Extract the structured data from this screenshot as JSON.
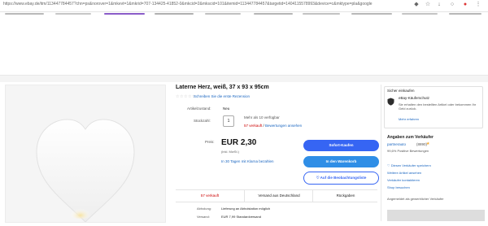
{
  "browser": {
    "url": "https://www.ebay.de/itm/113447784457?chn=ps&norover=1&mkevt=1&mkrid=707-134425-41852-0&mkcid=2&mkscid=101&itemid=113447784457&targetid=1404115578993&device=c&mktype=pla&google"
  },
  "product": {
    "title": "Laterne Herz, weiß, 37 x 93 x 95cm",
    "stars": "☆☆☆☆☆",
    "review_link": "Schreiben Sie die erste Rezension",
    "condition_label": "Artikelzustand:",
    "condition_value": "Neu",
    "quantity_label": "Stückzahl:",
    "quantity_value": "1",
    "availability": "Mehr als 10 verfügbar",
    "sold_text": "57 verkauft",
    "sold_link": "Bewertungen ansehen",
    "price_label": "Preis:",
    "price": "EUR 2,30",
    "price_sub": "(inkl. MwSt.)",
    "wish_link": "In 30 Tagen mit Klarna bezahlen",
    "buy_button": "Sofort-Kaufen",
    "cart_button": "In den Warenkorb",
    "watch_button": "♡ Auf die Beobachtungsliste"
  },
  "info_bar": {
    "sold": "57 verkauft",
    "shipping": "Versand aus Deutschland",
    "returns": "Rückgaben"
  },
  "shipping": {
    "label": "Abholung:",
    "value": "Lieferung an Abholstation möglich",
    "label2": "Versand:",
    "value2": "EUR 7,99 Standardversand"
  },
  "protection": {
    "title": "Sicher einkaufen",
    "head": "eBay-Käuferschutz",
    "text": "Sie erhalten den bestellten Artikel oder bekommen Ihr Geld zurück.",
    "link": "Mehr erfahren"
  },
  "seller": {
    "title": "Angaben zum Verkäufer",
    "name": "partnerauto",
    "count": "(8890)",
    "star": "★",
    "positive": "99,6% Positive Bewertungen",
    "save": "Diesen Verkäufer speichern",
    "other_items": "Weitere Artikel ansehen",
    "contact": "Verkäufer kontaktieren",
    "shop": "Shop besuchen",
    "type": "Angemeldet als gewerblicher Verkäufer"
  },
  "colors": {
    "accent": "#3665f3",
    "cart": "#2f8ee6",
    "sold": "#cc0000",
    "link": "#1a66c0"
  }
}
